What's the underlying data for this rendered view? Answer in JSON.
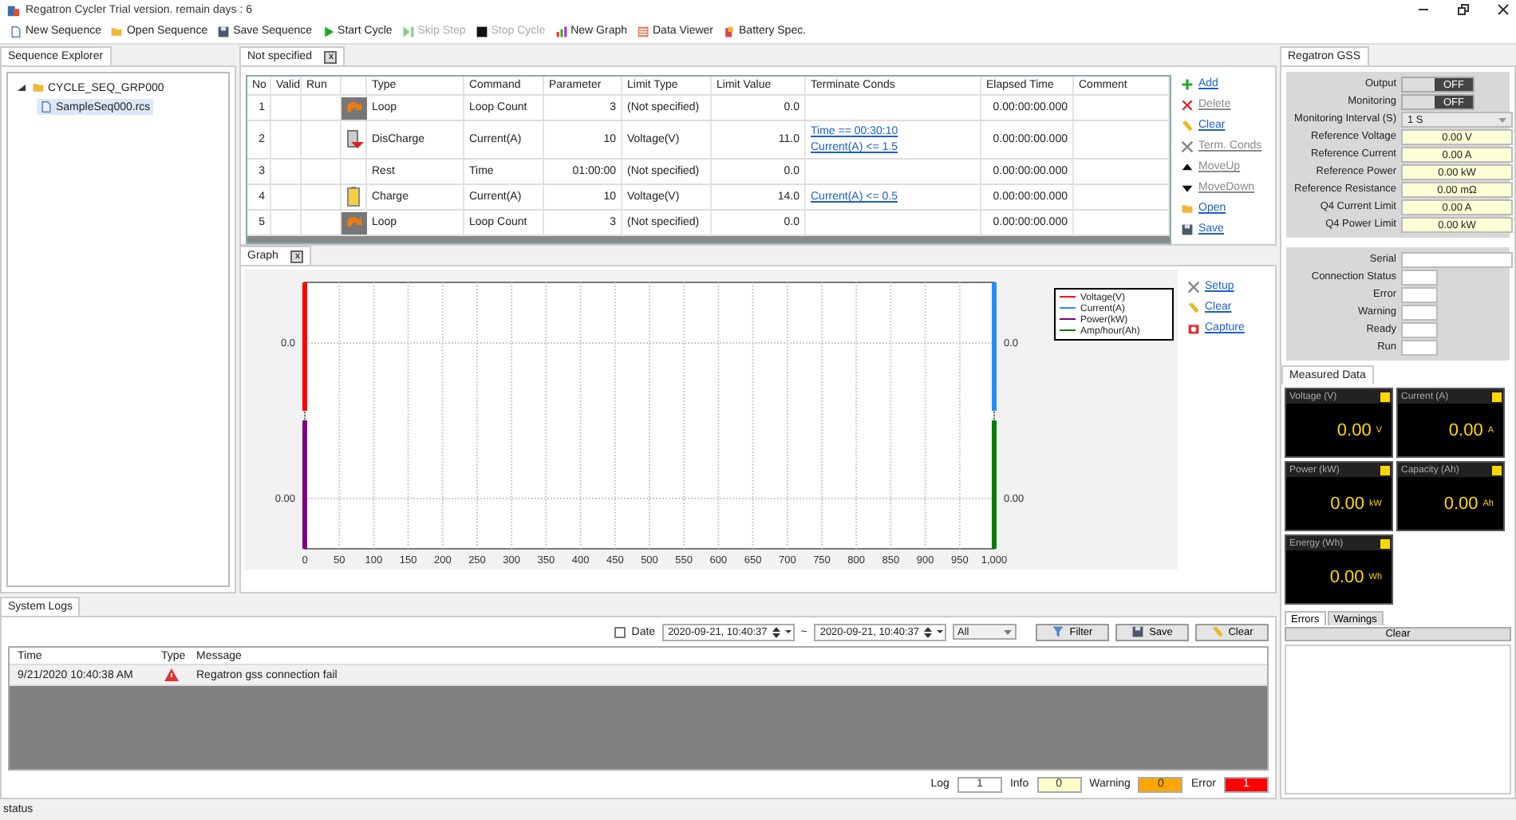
{
  "window": {
    "title": "Regatron Cycler Trial version. remain days : 6"
  },
  "toolbar": [
    {
      "label": "New Sequence",
      "kind": "page",
      "disabled": false
    },
    {
      "label": "Open Sequence",
      "kind": "folder",
      "disabled": false
    },
    {
      "label": "Save Sequence",
      "kind": "disk",
      "disabled": false
    },
    {
      "label": "Start Cycle",
      "kind": "play",
      "disabled": false
    },
    {
      "label": "Skip Step",
      "kind": "skip",
      "disabled": true
    },
    {
      "label": "Stop Cycle",
      "kind": "stop",
      "disabled": true
    },
    {
      "label": "New Graph",
      "kind": "graph",
      "disabled": false
    },
    {
      "label": "Data Viewer",
      "kind": "viewer",
      "disabled": false
    },
    {
      "label": "Battery Spec.",
      "kind": "battery",
      "disabled": false
    }
  ],
  "sequence_explorer": {
    "tab": "Sequence Explorer",
    "tree": [
      {
        "label": "CYCLE_SEQ_GRP000",
        "kind": "folder",
        "expanded": true,
        "selected": false,
        "children": [
          {
            "label": "SampleSeq000.rcs",
            "kind": "file",
            "selected": true
          }
        ]
      }
    ]
  },
  "sequence": {
    "tab": "Not specified",
    "close": "x",
    "columns": [
      {
        "kind": "text",
        "label": "No"
      },
      {
        "kind": "text",
        "label": "Valid"
      },
      {
        "kind": "text",
        "label": "Run"
      },
      {
        "kind": "icon"
      },
      {
        "kind": "text",
        "label": "Type"
      },
      {
        "kind": "text",
        "label": "Command"
      },
      {
        "kind": "text",
        "label": "Parameter"
      },
      {
        "kind": "text",
        "label": "Limit Type"
      },
      {
        "kind": "text",
        "label": "Limit Value"
      },
      {
        "kind": "text",
        "label": "Terminate Conds"
      },
      {
        "kind": "text",
        "label": "Elapsed Time"
      },
      {
        "kind": "text",
        "label": "Comment"
      }
    ],
    "rows": [
      {
        "no": "1",
        "kind": "loop",
        "type": "Loop",
        "command": "Loop Count",
        "parameter": "3",
        "limit_type": "(Not specified)",
        "limit_value": "0.0",
        "elapsed_time": "0.00:00:00.000"
      },
      {
        "no": "2",
        "kind": "discharge",
        "type": "DisCharge",
        "command": "Current(A)",
        "parameter": "10",
        "limit_type": "Voltage(V)",
        "limit_value": "11.0",
        "terminate_conds": [
          "Time == 00:30:10",
          "Current(A) <= 1.5"
        ],
        "elapsed_time": "0.00:00:00.000"
      },
      {
        "no": "3",
        "kind": "rest",
        "type": "Rest",
        "command": "Time",
        "parameter": "01:00:00",
        "limit_type": "(Not specified)",
        "limit_value": "0.0",
        "elapsed_time": "0.00:00:00.000"
      },
      {
        "no": "4",
        "kind": "charge",
        "type": "Charge",
        "command": "Current(A)",
        "parameter": "10",
        "limit_type": "Voltage(V)",
        "limit_value": "14.0",
        "terminate_conds": [
          "Current(A) <= 0.5"
        ],
        "elapsed_time": "0.00:00:00.000"
      },
      {
        "no": "5",
        "kind": "loop",
        "type": "Loop",
        "command": "Loop Count",
        "parameter": "3",
        "limit_type": "(Not specified)",
        "limit_value": "0.0",
        "elapsed_time": "0.00:00:00.000"
      }
    ],
    "actions": [
      {
        "label": "Add",
        "kind": "add",
        "disabled": false
      },
      {
        "label": "Delete",
        "kind": "delete",
        "disabled": true
      },
      {
        "label": "Clear",
        "kind": "clear",
        "disabled": false
      },
      {
        "label": "Term. Conds",
        "kind": "tools",
        "disabled": true
      },
      {
        "label": "MoveUp",
        "kind": "up",
        "disabled": true
      },
      {
        "label": "MoveDown",
        "kind": "down",
        "disabled": true
      },
      {
        "label": "Open",
        "kind": "open",
        "disabled": false
      },
      {
        "label": "Save",
        "kind": "save",
        "disabled": false
      }
    ]
  },
  "graph": {
    "tab": "Graph",
    "close": "x",
    "left_axis_labels": [
      "0.0",
      "0.00"
    ],
    "right_axis_labels": [
      "0.0",
      "0.00"
    ],
    "x_axis_labels": [
      "0",
      "50",
      "100",
      "150",
      "200",
      "250",
      "300",
      "350",
      "400",
      "450",
      "500",
      "550",
      "600",
      "650",
      "700",
      "750",
      "800",
      "850",
      "900",
      "950",
      "1,000"
    ],
    "legend": [
      {
        "name": "Voltage(V)",
        "color": "#ff0000"
      },
      {
        "name": "Current(A)",
        "color": "#1e90ff"
      },
      {
        "name": "Power(kW)",
        "color": "#800080"
      },
      {
        "name": "Amp/hour(Ah)",
        "color": "#008000"
      }
    ],
    "actions": [
      {
        "label": "Setup",
        "kind": "tools"
      },
      {
        "label": "Clear",
        "kind": "clear"
      },
      {
        "label": "Capture",
        "kind": "camera"
      }
    ]
  },
  "gss": {
    "tab": "Regatron GSS",
    "controls": [
      {
        "kind": "toggle",
        "label": "Output",
        "on": false,
        "text": "OFF"
      },
      {
        "kind": "toggle",
        "label": "Monitoring",
        "on": false,
        "text": "OFF"
      },
      {
        "kind": "select",
        "label": "Monitoring Interval (S)",
        "value": "1 S"
      },
      {
        "kind": "readout",
        "label": "Reference Voltage",
        "value": "0.00 V"
      },
      {
        "kind": "readout",
        "label": "Reference Current",
        "value": "0.00 A"
      },
      {
        "kind": "readout",
        "label": "Reference Power",
        "value": "0.00 kW"
      },
      {
        "kind": "readout",
        "label": "Reference Resistance",
        "value": "0.00 mΩ"
      },
      {
        "kind": "readout",
        "label": "Q4 Current Limit",
        "value": "0.00 A"
      },
      {
        "kind": "readout",
        "label": "Q4 Power Limit",
        "value": "0.00 kW"
      }
    ],
    "status": [
      {
        "label": "Serial",
        "kind": "wide"
      },
      {
        "label": "Connection Status",
        "kind": "small"
      },
      {
        "label": "Error",
        "kind": "small"
      },
      {
        "label": "Warning",
        "kind": "small"
      },
      {
        "label": "Ready",
        "kind": "small"
      },
      {
        "label": "Run",
        "kind": "small"
      }
    ]
  },
  "measured": {
    "tab": "Measured Data",
    "tiles": [
      {
        "label": "Voltage (V)",
        "value": "0.00",
        "unit": "V"
      },
      {
        "label": "Current (A)",
        "value": "0.00",
        "unit": "A"
      },
      {
        "label": "Power (kW)",
        "value": "0.00",
        "unit": "kW"
      },
      {
        "label": "Capacity (Ah)",
        "value": "0.00",
        "unit": "Ah"
      },
      {
        "label": "Energy (Wh)",
        "value": "0.00",
        "unit": "Wh"
      }
    ]
  },
  "alerts": {
    "tabs": [
      {
        "label": "Errors",
        "selected": true
      },
      {
        "label": "Warnings",
        "selected": false
      }
    ],
    "clear": "Clear"
  },
  "logs": {
    "tab": "System Logs",
    "date_filter": {
      "label": "Date",
      "checked": false,
      "from": "2020-09-21, 10:40:37",
      "separator": "~",
      "to": "2020-09-21, 10:40:37"
    },
    "level_select": "All",
    "buttons": [
      {
        "label": "Filter",
        "kind": "filter"
      },
      {
        "label": "Save",
        "kind": "save"
      },
      {
        "label": "Clear",
        "kind": "clear"
      }
    ],
    "columns": [
      "Time",
      "Type",
      "Message"
    ],
    "rows": [
      {
        "time": "9/21/2020 10:40:38 AM",
        "kind": "error",
        "message": "Regatron gss connection fail"
      }
    ],
    "counters": [
      {
        "label": "Log",
        "value": "1",
        "color": "#ffffff"
      },
      {
        "label": "Info",
        "value": "0",
        "color": "#ffffcc"
      },
      {
        "label": "Warning",
        "value": "0",
        "color": "#ffa500"
      },
      {
        "label": "Error",
        "value": "1",
        "color": "#ff0000"
      }
    ]
  },
  "status_bar": "status"
}
